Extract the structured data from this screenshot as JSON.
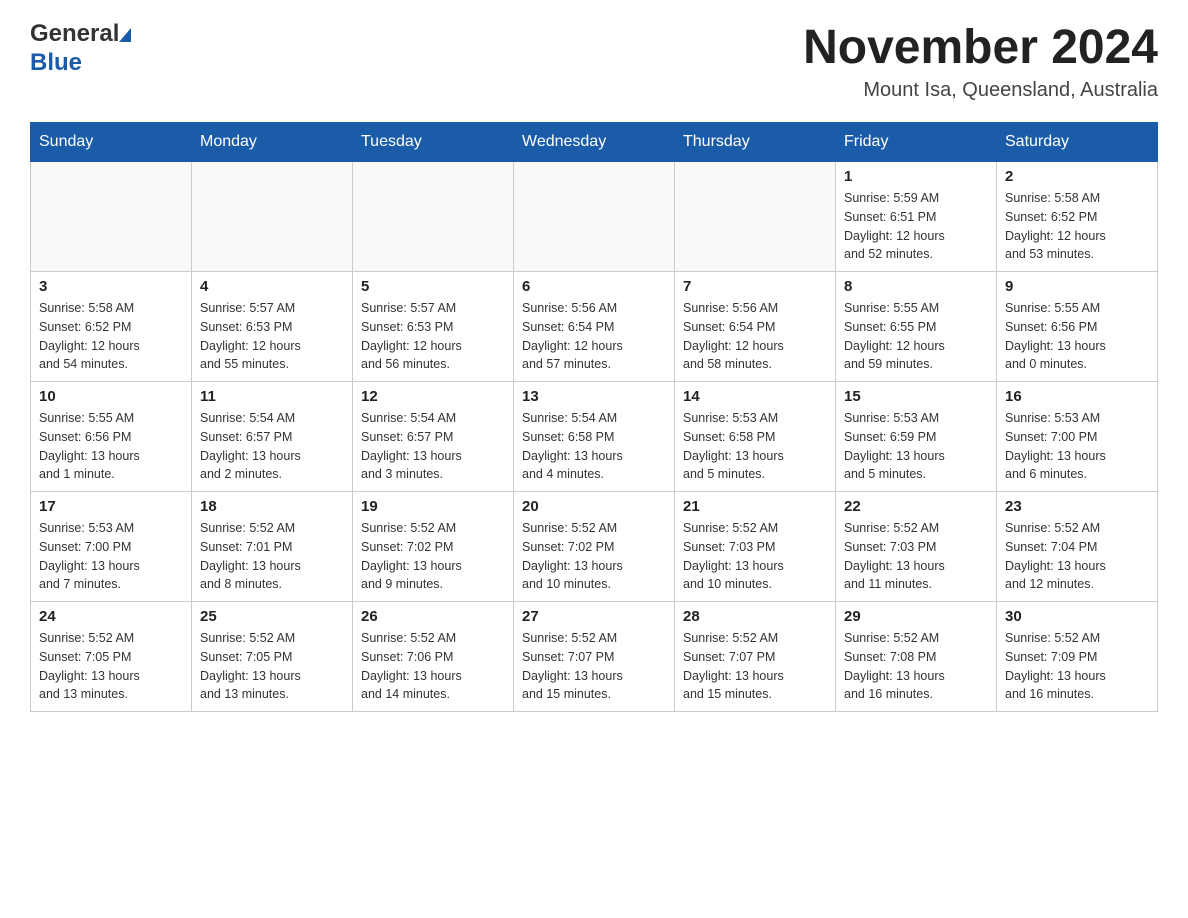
{
  "header": {
    "logo_general": "General",
    "logo_blue": "Blue",
    "title": "November 2024",
    "subtitle": "Mount Isa, Queensland, Australia"
  },
  "days_of_week": [
    "Sunday",
    "Monday",
    "Tuesday",
    "Wednesday",
    "Thursday",
    "Friday",
    "Saturday"
  ],
  "weeks": [
    [
      {
        "num": "",
        "info": ""
      },
      {
        "num": "",
        "info": ""
      },
      {
        "num": "",
        "info": ""
      },
      {
        "num": "",
        "info": ""
      },
      {
        "num": "",
        "info": ""
      },
      {
        "num": "1",
        "info": "Sunrise: 5:59 AM\nSunset: 6:51 PM\nDaylight: 12 hours\nand 52 minutes."
      },
      {
        "num": "2",
        "info": "Sunrise: 5:58 AM\nSunset: 6:52 PM\nDaylight: 12 hours\nand 53 minutes."
      }
    ],
    [
      {
        "num": "3",
        "info": "Sunrise: 5:58 AM\nSunset: 6:52 PM\nDaylight: 12 hours\nand 54 minutes."
      },
      {
        "num": "4",
        "info": "Sunrise: 5:57 AM\nSunset: 6:53 PM\nDaylight: 12 hours\nand 55 minutes."
      },
      {
        "num": "5",
        "info": "Sunrise: 5:57 AM\nSunset: 6:53 PM\nDaylight: 12 hours\nand 56 minutes."
      },
      {
        "num": "6",
        "info": "Sunrise: 5:56 AM\nSunset: 6:54 PM\nDaylight: 12 hours\nand 57 minutes."
      },
      {
        "num": "7",
        "info": "Sunrise: 5:56 AM\nSunset: 6:54 PM\nDaylight: 12 hours\nand 58 minutes."
      },
      {
        "num": "8",
        "info": "Sunrise: 5:55 AM\nSunset: 6:55 PM\nDaylight: 12 hours\nand 59 minutes."
      },
      {
        "num": "9",
        "info": "Sunrise: 5:55 AM\nSunset: 6:56 PM\nDaylight: 13 hours\nand 0 minutes."
      }
    ],
    [
      {
        "num": "10",
        "info": "Sunrise: 5:55 AM\nSunset: 6:56 PM\nDaylight: 13 hours\nand 1 minute."
      },
      {
        "num": "11",
        "info": "Sunrise: 5:54 AM\nSunset: 6:57 PM\nDaylight: 13 hours\nand 2 minutes."
      },
      {
        "num": "12",
        "info": "Sunrise: 5:54 AM\nSunset: 6:57 PM\nDaylight: 13 hours\nand 3 minutes."
      },
      {
        "num": "13",
        "info": "Sunrise: 5:54 AM\nSunset: 6:58 PM\nDaylight: 13 hours\nand 4 minutes."
      },
      {
        "num": "14",
        "info": "Sunrise: 5:53 AM\nSunset: 6:58 PM\nDaylight: 13 hours\nand 5 minutes."
      },
      {
        "num": "15",
        "info": "Sunrise: 5:53 AM\nSunset: 6:59 PM\nDaylight: 13 hours\nand 5 minutes."
      },
      {
        "num": "16",
        "info": "Sunrise: 5:53 AM\nSunset: 7:00 PM\nDaylight: 13 hours\nand 6 minutes."
      }
    ],
    [
      {
        "num": "17",
        "info": "Sunrise: 5:53 AM\nSunset: 7:00 PM\nDaylight: 13 hours\nand 7 minutes."
      },
      {
        "num": "18",
        "info": "Sunrise: 5:52 AM\nSunset: 7:01 PM\nDaylight: 13 hours\nand 8 minutes."
      },
      {
        "num": "19",
        "info": "Sunrise: 5:52 AM\nSunset: 7:02 PM\nDaylight: 13 hours\nand 9 minutes."
      },
      {
        "num": "20",
        "info": "Sunrise: 5:52 AM\nSunset: 7:02 PM\nDaylight: 13 hours\nand 10 minutes."
      },
      {
        "num": "21",
        "info": "Sunrise: 5:52 AM\nSunset: 7:03 PM\nDaylight: 13 hours\nand 10 minutes."
      },
      {
        "num": "22",
        "info": "Sunrise: 5:52 AM\nSunset: 7:03 PM\nDaylight: 13 hours\nand 11 minutes."
      },
      {
        "num": "23",
        "info": "Sunrise: 5:52 AM\nSunset: 7:04 PM\nDaylight: 13 hours\nand 12 minutes."
      }
    ],
    [
      {
        "num": "24",
        "info": "Sunrise: 5:52 AM\nSunset: 7:05 PM\nDaylight: 13 hours\nand 13 minutes."
      },
      {
        "num": "25",
        "info": "Sunrise: 5:52 AM\nSunset: 7:05 PM\nDaylight: 13 hours\nand 13 minutes."
      },
      {
        "num": "26",
        "info": "Sunrise: 5:52 AM\nSunset: 7:06 PM\nDaylight: 13 hours\nand 14 minutes."
      },
      {
        "num": "27",
        "info": "Sunrise: 5:52 AM\nSunset: 7:07 PM\nDaylight: 13 hours\nand 15 minutes."
      },
      {
        "num": "28",
        "info": "Sunrise: 5:52 AM\nSunset: 7:07 PM\nDaylight: 13 hours\nand 15 minutes."
      },
      {
        "num": "29",
        "info": "Sunrise: 5:52 AM\nSunset: 7:08 PM\nDaylight: 13 hours\nand 16 minutes."
      },
      {
        "num": "30",
        "info": "Sunrise: 5:52 AM\nSunset: 7:09 PM\nDaylight: 13 hours\nand 16 minutes."
      }
    ]
  ]
}
